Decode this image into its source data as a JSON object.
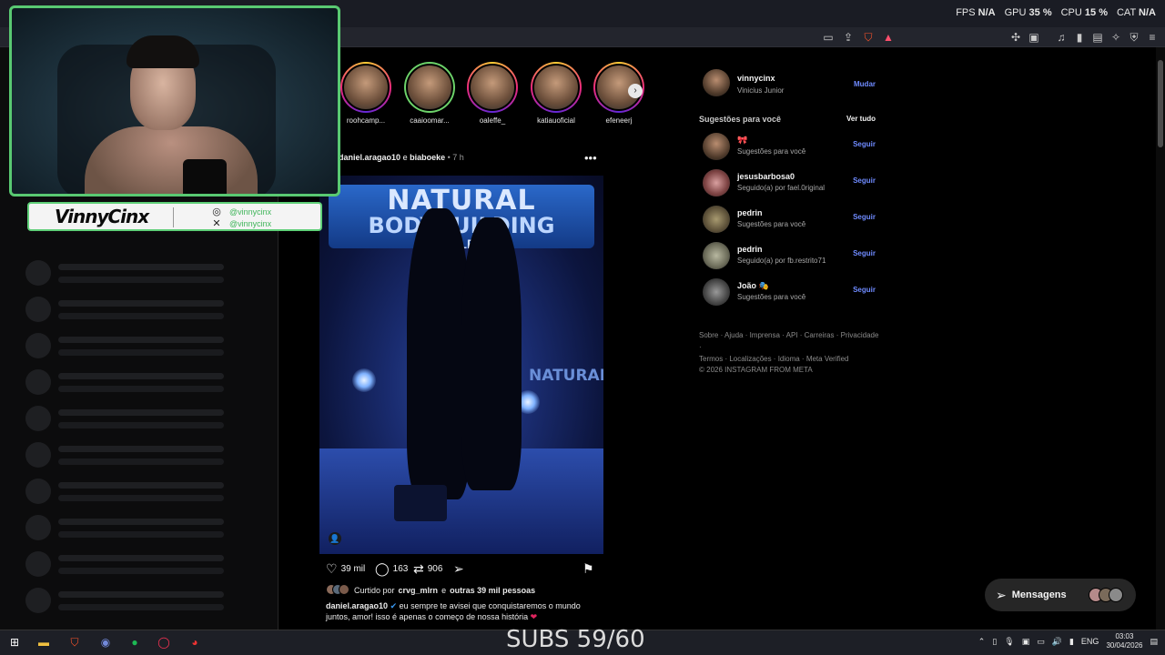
{
  "stats": {
    "fps_label": "FPS",
    "fps": "N/A",
    "gpu_label": "GPU",
    "gpu": "35 %",
    "cpu_label": "CPU",
    "cpu": "15 %",
    "cat_label": "CAT",
    "cat": "N/A"
  },
  "stream": {
    "nickname": "VinnyCinx",
    "instagram": "@vinnycinx",
    "x": "@vinnycinx",
    "subs": "SUBS 59/60"
  },
  "stories": [
    {
      "name": "roohcamp..."
    },
    {
      "name": "caaioomar..."
    },
    {
      "name": "oaleffe_"
    },
    {
      "name": "katiauoficial"
    },
    {
      "name": "efeneerj"
    }
  ],
  "post": {
    "author": "daniel.aragao10",
    "conj": "e",
    "coauthor": "biaboeke",
    "sep": "•",
    "time": "7 h",
    "photo_banner_1": "NATURAL",
    "photo_banner_2": "BODYBUILDING",
    "photo_banner_3": "PO ALEGR",
    "photo_stage": "NATURAL",
    "likes": "39 mil",
    "comments": "163",
    "reposts": "906",
    "liked_prefix": "Curtido por",
    "liked_user": "crvg_mlrn",
    "liked_conj": "e",
    "liked_others": "outras 39 mil pessoas",
    "caption_user": "daniel.aragao10",
    "caption_text": "eu sempre te avisei que conquistaremos o mundo juntos, amor! isso é apenas o começo de nossa história"
  },
  "profile": {
    "username": "vinnycinx",
    "fullname": "Vinicius Junior",
    "switch": "Mudar"
  },
  "suggestions": {
    "title": "Sugestões para você",
    "see_all": "Ver tudo",
    "items": [
      {
        "name": "🎀",
        "sub": "Sugestões para você",
        "action": "Seguir"
      },
      {
        "name": "jesusbarbosa0",
        "sub": "Seguido(a) por fael.0riginal",
        "action": "Seguir"
      },
      {
        "name": "pedrin",
        "sub": "Sugestões para você",
        "action": "Seguir"
      },
      {
        "name": "pedrin",
        "sub": "Seguido(a) por fb.restrito71",
        "action": "Seguir"
      },
      {
        "name": "João 🎭",
        "sub": "Sugestões para você",
        "action": "Seguir"
      }
    ]
  },
  "footer": {
    "line1": "Sobre · Ajuda · Imprensa · API · Carreiras · Privacidade ·",
    "line2": "Termos · Localizações · Idioma · Meta Verified",
    "copyright": "© 2026 INSTAGRAM FROM META"
  },
  "messages": {
    "label": "Mensagens"
  },
  "taskbar": {
    "lang": "ENG",
    "time": "03:03",
    "date": "30/04/2026"
  }
}
